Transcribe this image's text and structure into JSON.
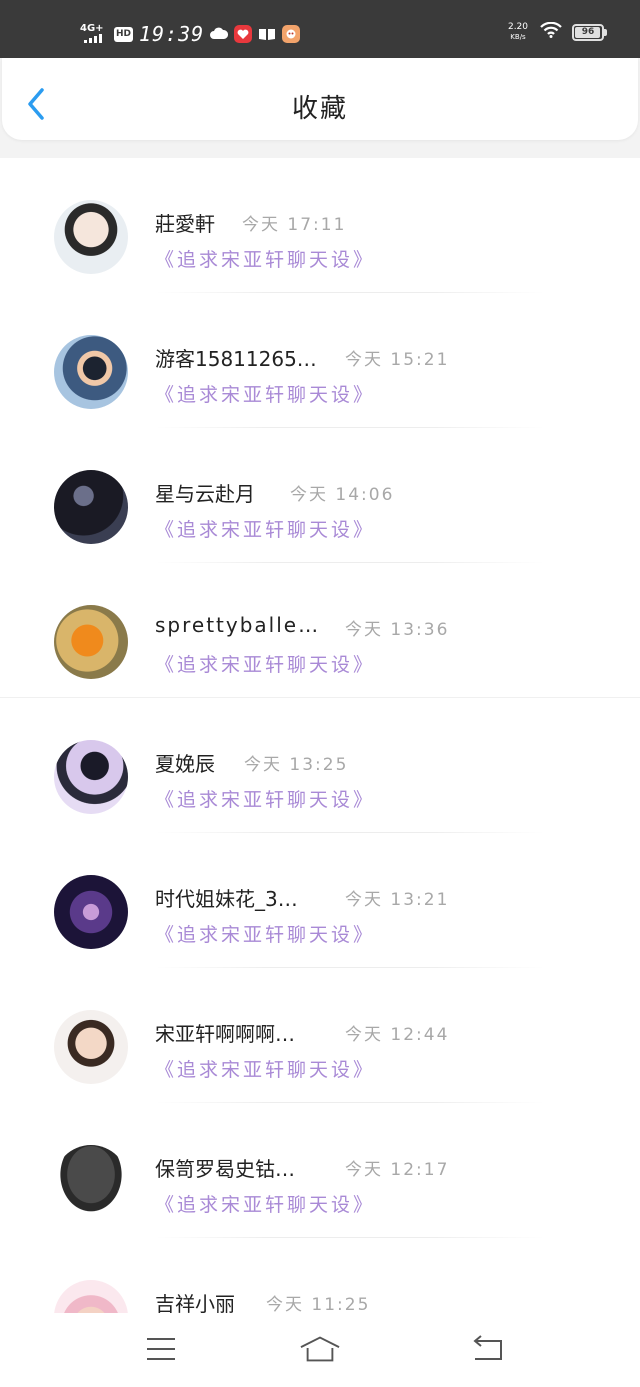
{
  "status_bar": {
    "network": "4G+",
    "hd": "HD",
    "time": "19:39",
    "speed_value": "2.20",
    "speed_unit": "KB/s",
    "battery": "96",
    "battery_level": 0.96,
    "icons": [
      "signal-icon",
      "hd-icon",
      "cloud-icon",
      "heart-app-icon",
      "book-icon",
      "game-app-icon",
      "wifi-icon",
      "battery-icon"
    ]
  },
  "header": {
    "title": "收藏",
    "back_icon": "chevron-left-icon",
    "accent": "#2b9cf0"
  },
  "items": [
    {
      "name": "莊愛軒",
      "time": "今天 17:11",
      "title": "《追求宋亚轩聊天设》"
    },
    {
      "name": "游客15811265…",
      "time": "今天 15:21",
      "title": "《追求宋亚轩聊天设》"
    },
    {
      "name": "星与云赴月",
      "time": "今天 14:06",
      "title": "《追求宋亚轩聊天设》"
    },
    {
      "name": "sprettyballe…",
      "time": "今天 13:36",
      "title": "《追求宋亚轩聊天设》"
    },
    {
      "name": "夏娩辰",
      "time": "今天 13:25",
      "title": "《追求宋亚轩聊天设》"
    },
    {
      "name": "时代姐妹花_3…",
      "time": "今天 13:21",
      "title": "《追求宋亚轩聊天设》"
    },
    {
      "name": "宋亚轩啊啊啊…",
      "time": "今天 12:44",
      "title": "《追求宋亚轩聊天设》"
    },
    {
      "name": "保笥罗曷史钴…",
      "time": "今天 12:17",
      "title": "《追求宋亚轩聊天设》"
    },
    {
      "name": "吉祥小丽",
      "time": "今天 11:25",
      "title": ""
    }
  ],
  "nav": {
    "icons": [
      "menu-icon",
      "home-icon",
      "back-icon"
    ]
  },
  "colors": {
    "title_purple": "#a98ad6",
    "time_gray": "#a8a8a8",
    "status_bar_bg": "#3a3a3a"
  }
}
